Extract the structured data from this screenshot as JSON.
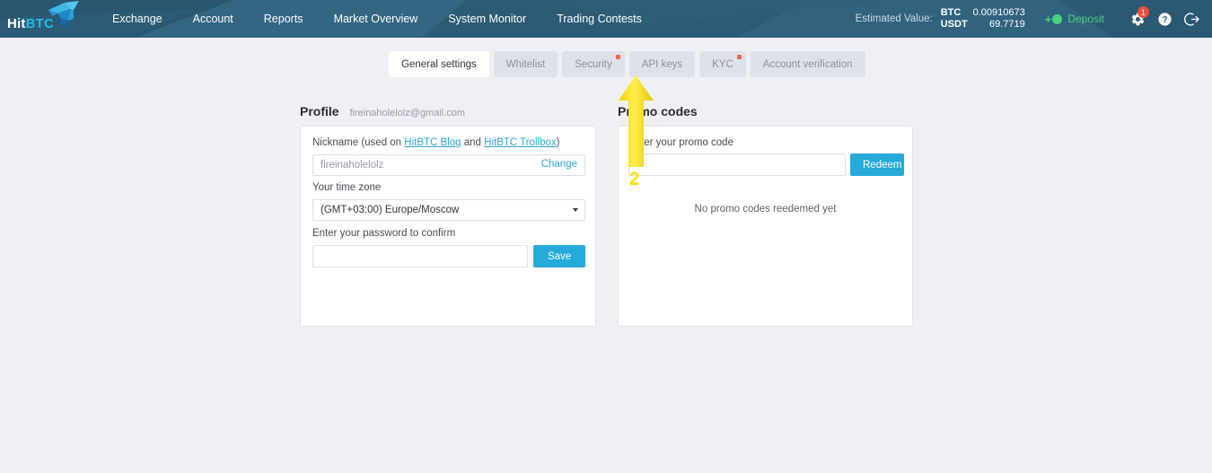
{
  "header": {
    "logo": {
      "part1": "Hit",
      "part2": "BTC",
      "icon": "hitbtc-fish-logo"
    },
    "nav": [
      {
        "label": "Exchange"
      },
      {
        "label": "Account"
      },
      {
        "label": "Reports"
      },
      {
        "label": "Market Overview"
      },
      {
        "label": "System Monitor"
      },
      {
        "label": "Trading Contests"
      }
    ],
    "estimated": {
      "label": "Estimated Value:",
      "rows": [
        {
          "currency": "BTC",
          "amount": "0.00910673"
        },
        {
          "currency": "USDT",
          "amount": "69.7719"
        }
      ]
    },
    "deposit": {
      "label": "Deposit",
      "plus": "+"
    },
    "settings_badge": "1",
    "help_glyph": "?",
    "colors": {
      "bar_background": "#2e5d77",
      "brand_cyan": "#29b6e8",
      "deposit_green": "#4bd07f",
      "badge_red": "#ef4b3b"
    }
  },
  "tabs": [
    {
      "label": "General settings",
      "active": true,
      "dot": false
    },
    {
      "label": "Whitelist",
      "active": false,
      "dot": false
    },
    {
      "label": "Security",
      "active": false,
      "dot": true
    },
    {
      "label": "API keys",
      "active": false,
      "dot": false
    },
    {
      "label": "KYC",
      "active": false,
      "dot": true
    },
    {
      "label": "Account verification",
      "active": false,
      "dot": false
    }
  ],
  "profile": {
    "title": "Profile",
    "email": "fireinaholelolz@gmail.com",
    "nickname": {
      "label_before": "Nickname (used on ",
      "link1": "HitBTC Blog",
      "label_middle": " and ",
      "link2": "HitBTC Trollbox",
      "label_after": ")",
      "value": "",
      "placeholder": "fireinaholelolz",
      "change_label": "Change"
    },
    "timezone": {
      "label": "Your time zone",
      "selected": "(GMT+03:00) Europe/Moscow"
    },
    "password": {
      "label": "Enter your password to confirm",
      "value": "",
      "placeholder": "",
      "save_label": "Save"
    }
  },
  "promo": {
    "title": "Promo codes",
    "input_label": "Enter your promo code",
    "value": "",
    "placeholder": "",
    "redeem_label": "Redeem",
    "empty_message": "No promo codes reedemed yet"
  },
  "annotation": {
    "step_number": "2",
    "arrow_color": "#ffe000",
    "points_to": "API keys"
  }
}
